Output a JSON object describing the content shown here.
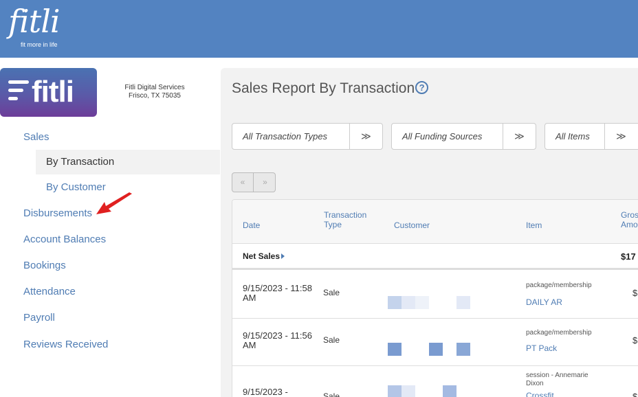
{
  "header": {
    "logo_text": "fitli",
    "tagline": "fit more in life"
  },
  "brand": {
    "logo_text": "fitli",
    "company_name": "Fitli Digital Services",
    "company_location": "Frisco, TX 75035"
  },
  "sidebar": {
    "items": [
      {
        "label": "Sales"
      },
      {
        "label": "By Transaction"
      },
      {
        "label": "By Customer"
      },
      {
        "label": "Disbursements"
      },
      {
        "label": "Account Balances"
      },
      {
        "label": "Bookings"
      },
      {
        "label": "Attendance"
      },
      {
        "label": "Payroll"
      },
      {
        "label": "Reviews Received"
      }
    ]
  },
  "main": {
    "title": "Sales Report By Transaction",
    "help_glyph": "?",
    "filters": [
      {
        "label": "All Transaction Types"
      },
      {
        "label": "All Funding Sources"
      },
      {
        "label": "All Items"
      }
    ],
    "chevron_glyph": "≫",
    "pager": {
      "prev": "«",
      "next": "»"
    },
    "table": {
      "columns": [
        "Date",
        "Transaction Type",
        "Customer",
        "Item",
        "Gross Amount"
      ],
      "net_sales": {
        "label": "Net Sales",
        "amount": "$17"
      },
      "rows": [
        {
          "date": "9/15/2023 - 11:58 AM",
          "type": "Sale",
          "category": "package/membership",
          "item": "DAILY AR",
          "amount": "$"
        },
        {
          "date": "9/15/2023 - 11:56 AM",
          "type": "Sale",
          "category": "package/membership",
          "item": "PT Pack",
          "amount": "$"
        },
        {
          "date": "9/15/2023 -",
          "type": "Sale",
          "category": "session - Annemarie Dixon",
          "item": "Crossfit",
          "amount": "$"
        }
      ]
    }
  },
  "colors": {
    "header_bg": "#5383c1",
    "link": "#4f7cb3",
    "active_bg": "#f2f2f2",
    "arrow": "#e02020"
  }
}
